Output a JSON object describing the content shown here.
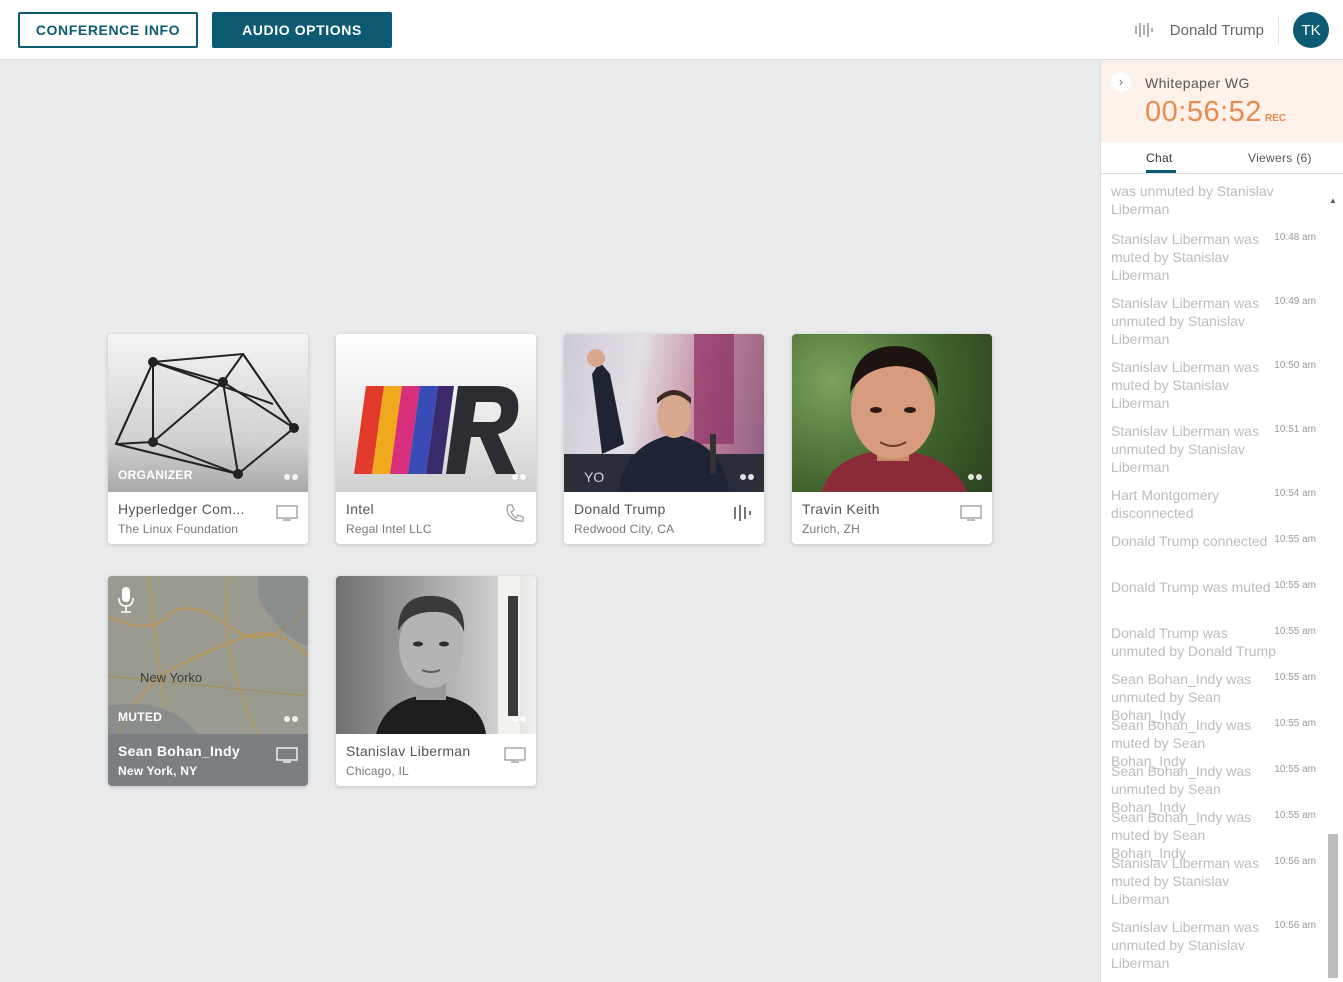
{
  "header": {
    "conference_info_label": "CONFERENCE INFO",
    "audio_options_label": "AUDIO OPTIONS",
    "user_name": "Donald Trump",
    "avatar_initials": "TK"
  },
  "tiles": [
    {
      "name": "Hyperledger Com...",
      "location": "The Linux Foundation",
      "badge": "ORGANIZER",
      "device": "monitor-icon"
    },
    {
      "name": "Intel",
      "location": "Regal Intel LLC",
      "badge": "",
      "device": "phone-icon"
    },
    {
      "name": "Donald Trump",
      "location": "Redwood City, CA",
      "badge": "",
      "device": "audio-bars-icon"
    },
    {
      "name": "Travin Keith",
      "location": "Zurich, ZH",
      "badge": "",
      "device": "monitor-icon"
    },
    {
      "name": "Sean Bohan_Indy",
      "location": "New York, NY",
      "badge": "MUTED",
      "device": "monitor-icon",
      "map_label": "New Yorko"
    },
    {
      "name": "Stanislav Liberman",
      "location": "Chicago, IL",
      "badge": "",
      "device": "monitor-icon"
    }
  ],
  "panel": {
    "conference_title": "Whitepaper WG",
    "timer": "00:56:52",
    "rec_label": "REC",
    "tabs": {
      "chat": "Chat",
      "viewers": "Viewers (6)"
    },
    "messages": [
      {
        "text": "was unmuted by Stanislav Liberman",
        "time": ""
      },
      {
        "text": "Stanislav Liberman was muted by Stanislav Liberman",
        "time": "10:48 am"
      },
      {
        "text": "Stanislav Liberman was unmuted by Stanislav Liberman",
        "time": "10:49 am"
      },
      {
        "text": "Stanislav Liberman was muted by Stanislav Liberman",
        "time": "10:50 am"
      },
      {
        "text": "Stanislav Liberman was unmuted by Stanislav Liberman",
        "time": "10:51 am"
      },
      {
        "text": "Hart Montgomery disconnected",
        "time": "10:54 am"
      },
      {
        "text": "Donald Trump connected",
        "time": "10:55 am"
      },
      {
        "text": "Donald Trump was muted",
        "time": "10:55 am"
      },
      {
        "text": "Donald Trump was unmuted by Donald Trump",
        "time": "10:55 am"
      },
      {
        "text": "Sean Bohan_Indy was unmuted by Sean Bohan_Indy",
        "time": "10:55 am"
      },
      {
        "text": "Sean Bohan_Indy was muted by Sean Bohan_Indy",
        "time": "10:55 am"
      },
      {
        "text": "Sean Bohan_Indy was unmuted by Sean Bohan_Indy",
        "time": "10:55 am"
      },
      {
        "text": "Sean Bohan_Indy was muted by Sean Bohan_Indy",
        "time": "10:55 am"
      },
      {
        "text": "Stanislav Liberman was muted by Stanislav Liberman",
        "time": "10:56 am"
      },
      {
        "text": "Stanislav Liberman was unmuted by Stanislav Liberman",
        "time": "10:56 am"
      }
    ]
  },
  "colors": {
    "accent": "#0d5b73",
    "timer": "#e88a4f"
  }
}
